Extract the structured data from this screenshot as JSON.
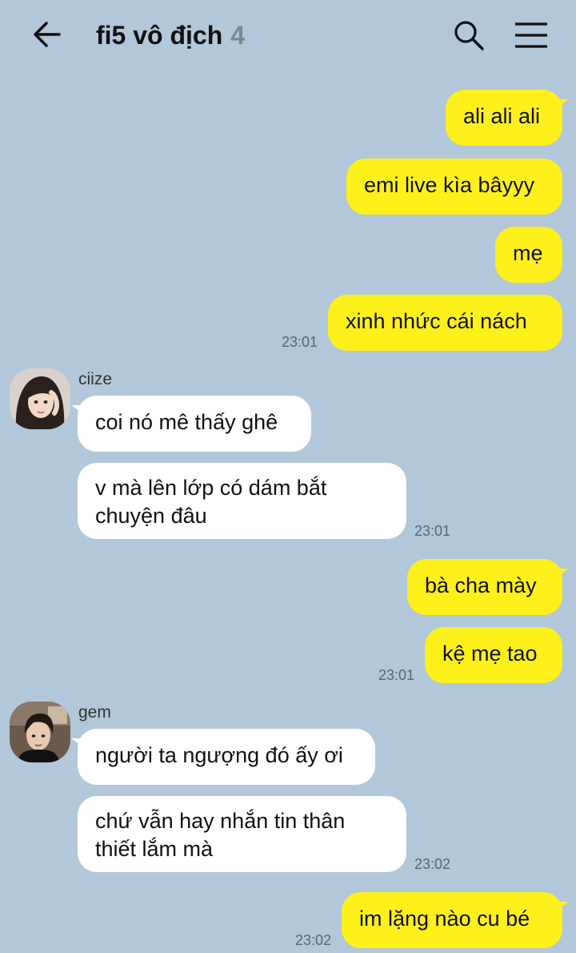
{
  "header": {
    "title": "fi5 vô địch",
    "member_count": "4",
    "back_icon": "arrow-left-icon",
    "search_icon": "search-icon",
    "menu_icon": "hamburger-menu-icon"
  },
  "colors": {
    "background": "#b2c7da",
    "my_bubble": "#fef01b",
    "their_bubble": "#ffffff"
  },
  "messages": [
    {
      "from": "me",
      "text": "ali ali ali"
    },
    {
      "from": "me",
      "text": "emi live kìa bâyyy"
    },
    {
      "from": "me",
      "text": "mẹ"
    },
    {
      "from": "me",
      "text": "xinh nhức cái nách",
      "time": "23:01"
    },
    {
      "from": "ciize",
      "text": "coi nó mê thấy ghê"
    },
    {
      "from": "ciize",
      "text_line1": "v mà lên lớp có dám bắt",
      "text_line2": "chuyện đâu",
      "time": "23:01"
    },
    {
      "from": "me",
      "text": "bà cha mày"
    },
    {
      "from": "me",
      "text": "kệ mẹ tao",
      "time": "23:01"
    },
    {
      "from": "gem",
      "text": "người ta ngượng đó ấy ơi"
    },
    {
      "from": "gem",
      "text_line1": "chứ vẫn hay nhắn tin thân",
      "text_line2": "thiết lắm mà",
      "time": "23:02"
    },
    {
      "from": "me",
      "text": "im lặng nào cu bé",
      "time": "23:02"
    }
  ],
  "senders": {
    "ciize": "ciize",
    "gem": "gem"
  }
}
